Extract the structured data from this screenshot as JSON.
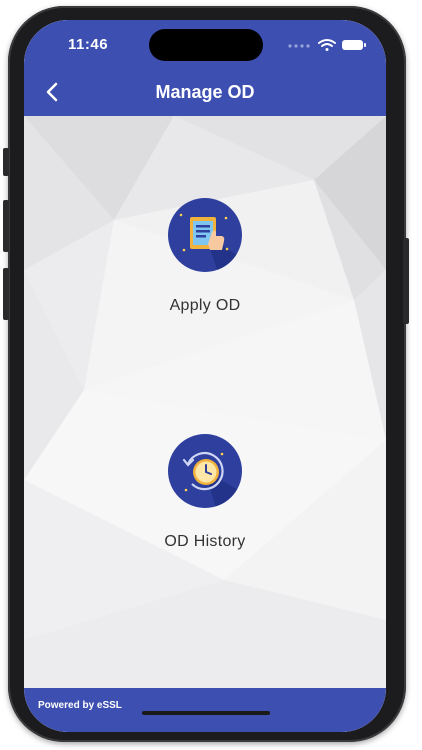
{
  "status_bar": {
    "time": "11:46",
    "icons": [
      "signal-dots-icon",
      "wifi-icon",
      "battery-icon"
    ]
  },
  "header": {
    "back_icon": "chevron-left-icon",
    "title": "Manage OD",
    "background_color": "#3d4fb1"
  },
  "menu": {
    "items": [
      {
        "label": "Apply OD",
        "icon": "form-hand-icon"
      },
      {
        "label": "OD History",
        "icon": "clock-history-icon"
      }
    ]
  },
  "footer": {
    "powered_by": "Powered by eSSL",
    "background_color": "#3d4fb1"
  },
  "colors": {
    "accent": "#3d4fb1",
    "icon_circle": "#2e3f9e",
    "label_text": "#333333"
  }
}
